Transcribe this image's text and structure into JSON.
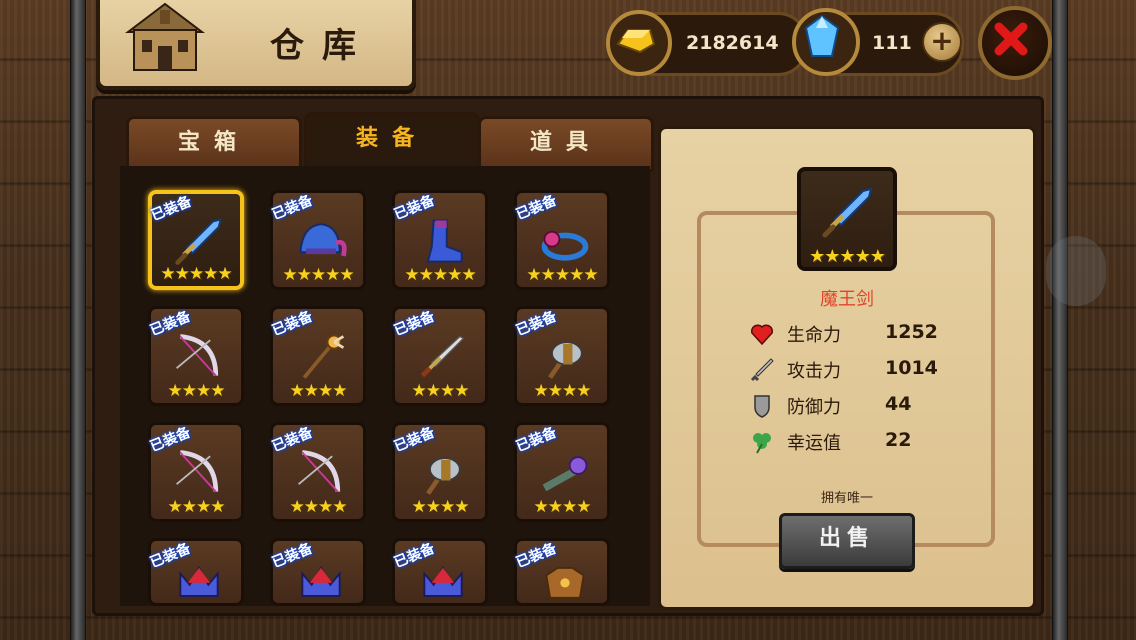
{
  "header": {
    "title": "仓库",
    "gold": "2182614",
    "diamonds": "111"
  },
  "tabs": [
    {
      "label": "宝箱",
      "active": false
    },
    {
      "label": "装备",
      "active": true
    },
    {
      "label": "道具",
      "active": false
    }
  ],
  "equipped_badge": "已装备",
  "items": [
    {
      "icon": "sword-icon",
      "stars": "★★★★★",
      "selected": true
    },
    {
      "icon": "helmet-icon",
      "stars": "★★★★★"
    },
    {
      "icon": "boots-icon",
      "stars": "★★★★★"
    },
    {
      "icon": "ring-icon",
      "stars": "★★★★★"
    },
    {
      "icon": "bow-icon",
      "stars": "★★★★"
    },
    {
      "icon": "staff-icon",
      "stars": "★★★★"
    },
    {
      "icon": "dagger-icon",
      "stars": "★★★★"
    },
    {
      "icon": "axe-icon",
      "stars": "★★★★"
    },
    {
      "icon": "bow-icon",
      "stars": "★★★★"
    },
    {
      "icon": "bow-icon",
      "stars": "★★★★"
    },
    {
      "icon": "axe-icon",
      "stars": "★★★★"
    },
    {
      "icon": "cannon-icon",
      "stars": "★★★★"
    },
    {
      "icon": "crown-icon",
      "stars": ""
    },
    {
      "icon": "crown-icon",
      "stars": ""
    },
    {
      "icon": "crown-icon",
      "stars": ""
    },
    {
      "icon": "armor-icon",
      "stars": ""
    }
  ],
  "detail": {
    "stars": "★★★★★",
    "name": "魔王剑",
    "stats": [
      {
        "icon": "heart-icon",
        "label": "生命力",
        "value": "1252"
      },
      {
        "icon": "sword-stat-icon",
        "label": "攻击力",
        "value": "1014"
      },
      {
        "icon": "shield-icon",
        "label": "防御力",
        "value": "44"
      },
      {
        "icon": "clover-icon",
        "label": "幸运值",
        "value": "22"
      }
    ],
    "unique_note": "拥有唯一",
    "sell_label": "出售"
  },
  "colors": {
    "accent": "#f6c21c",
    "item_name": "#e2442a",
    "badge": "#1d4fd6"
  }
}
